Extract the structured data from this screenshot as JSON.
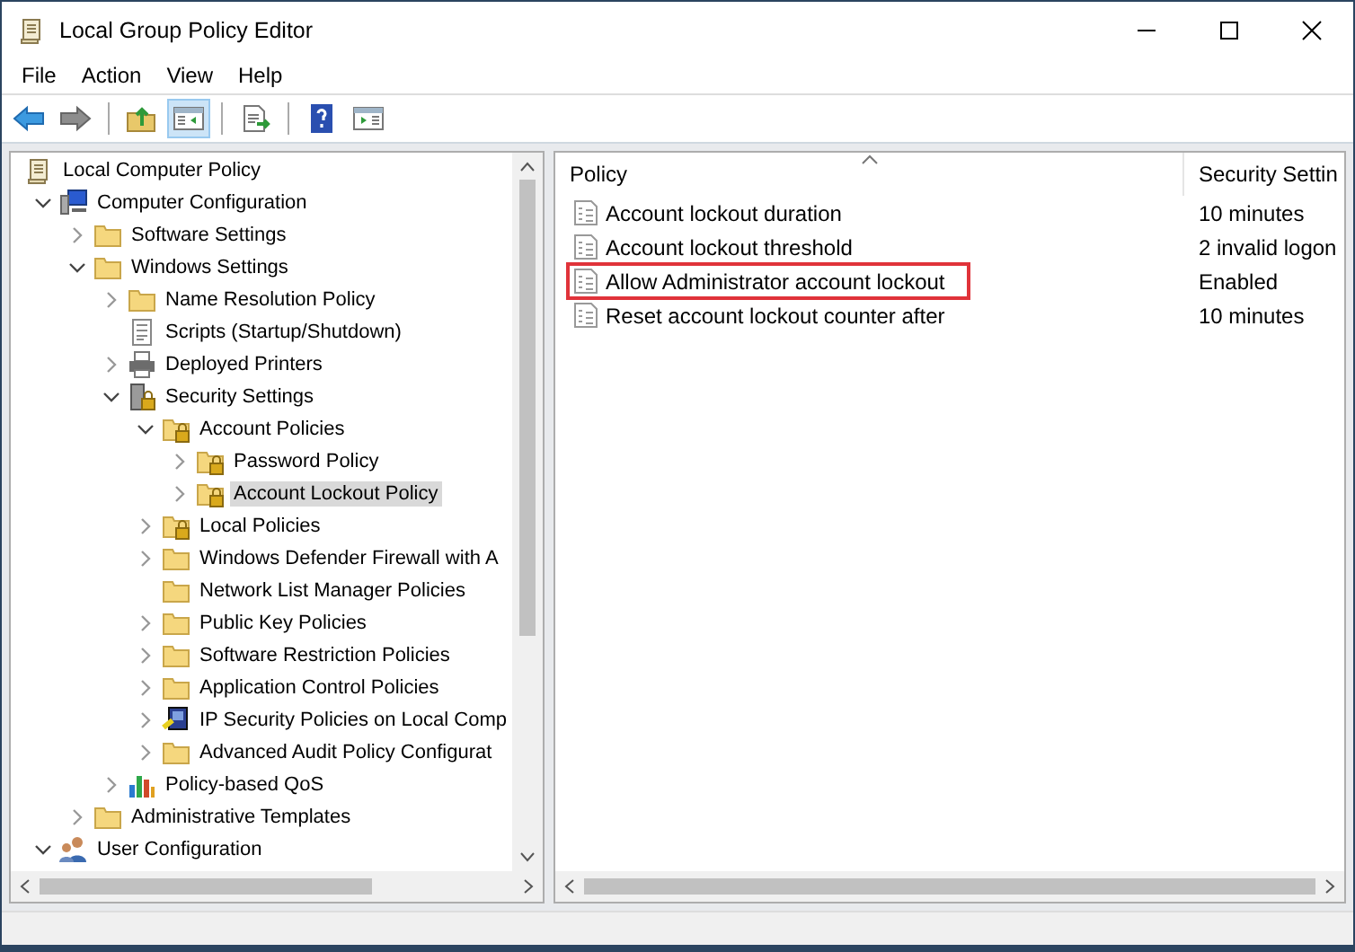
{
  "window": {
    "title": "Local Group Policy Editor"
  },
  "menu": [
    "File",
    "Action",
    "View",
    "Help"
  ],
  "toolbar": [
    {
      "kind": "back",
      "pressed": false
    },
    {
      "kind": "forward",
      "pressed": false
    },
    {
      "kind": "up",
      "pressed": false
    },
    {
      "kind": "tree-toggle",
      "pressed": true
    },
    {
      "kind": "export",
      "pressed": false
    },
    {
      "kind": "help",
      "pressed": false
    },
    {
      "kind": "action-toggle",
      "pressed": false
    }
  ],
  "tree": [
    {
      "label": "Local Computer Policy",
      "kind": "policy",
      "expandable": false,
      "selected": false,
      "children": [
        {
          "label": "Computer Configuration",
          "kind": "computer",
          "expandable": true,
          "expanded": true,
          "selected": false,
          "children": [
            {
              "label": "Software Settings",
              "kind": "folder",
              "expandable": true,
              "expanded": false,
              "selected": false
            },
            {
              "label": "Windows Settings",
              "kind": "folder",
              "expandable": true,
              "expanded": true,
              "selected": false,
              "children": [
                {
                  "label": "Name Resolution Policy",
                  "kind": "folder",
                  "expandable": true,
                  "expanded": false,
                  "selected": false
                },
                {
                  "label": "Scripts (Startup/Shutdown)",
                  "kind": "script",
                  "expandable": false,
                  "selected": false
                },
                {
                  "label": "Deployed Printers",
                  "kind": "printer",
                  "expandable": true,
                  "expanded": false,
                  "selected": false
                },
                {
                  "label": "Security Settings",
                  "kind": "security",
                  "expandable": true,
                  "expanded": true,
                  "selected": false,
                  "children": [
                    {
                      "label": "Account Policies",
                      "kind": "lock-folder",
                      "expandable": true,
                      "expanded": true,
                      "selected": false,
                      "children": [
                        {
                          "label": "Password Policy",
                          "kind": "lock-folder",
                          "expandable": true,
                          "expanded": false,
                          "selected": false
                        },
                        {
                          "label": "Account Lockout Policy",
                          "kind": "lock-folder",
                          "expandable": true,
                          "expanded": false,
                          "selected": true
                        }
                      ]
                    },
                    {
                      "label": "Local Policies",
                      "kind": "lock-folder",
                      "expandable": true,
                      "expanded": false,
                      "selected": false
                    },
                    {
                      "label": "Windows Defender Firewall with A",
                      "kind": "folder",
                      "expandable": true,
                      "expanded": false,
                      "selected": false
                    },
                    {
                      "label": "Network List Manager Policies",
                      "kind": "folder",
                      "expandable": false,
                      "selected": false
                    },
                    {
                      "label": "Public Key Policies",
                      "kind": "folder",
                      "expandable": true,
                      "expanded": false,
                      "selected": false
                    },
                    {
                      "label": "Software Restriction Policies",
                      "kind": "folder",
                      "expandable": true,
                      "expanded": false,
                      "selected": false
                    },
                    {
                      "label": "Application Control Policies",
                      "kind": "folder",
                      "expandable": true,
                      "expanded": false,
                      "selected": false
                    },
                    {
                      "label": "IP Security Policies on Local Comp",
                      "kind": "ip-security",
                      "expandable": true,
                      "expanded": false,
                      "selected": false
                    },
                    {
                      "label": "Advanced Audit Policy Configurat",
                      "kind": "folder",
                      "expandable": true,
                      "expanded": false,
                      "selected": false
                    }
                  ]
                },
                {
                  "label": "Policy-based QoS",
                  "kind": "chart",
                  "expandable": true,
                  "expanded": false,
                  "selected": false
                }
              ]
            },
            {
              "label": "Administrative Templates",
              "kind": "folder",
              "expandable": true,
              "expanded": false,
              "selected": false
            }
          ]
        },
        {
          "label": "User Configuration",
          "kind": "user",
          "expandable": true,
          "expanded": true,
          "selected": false
        }
      ]
    }
  ],
  "table": {
    "columns": [
      "Policy",
      "Security Settin"
    ],
    "rows": [
      {
        "policy": "Account lockout duration",
        "setting": "10 minutes",
        "highlighted": false
      },
      {
        "policy": "Account lockout threshold",
        "setting": "2 invalid logon",
        "highlighted": false
      },
      {
        "policy": "Allow Administrator account lockout",
        "setting": "Enabled",
        "highlighted": true
      },
      {
        "policy": "Reset account lockout counter after",
        "setting": "10 minutes",
        "highlighted": false
      }
    ]
  }
}
